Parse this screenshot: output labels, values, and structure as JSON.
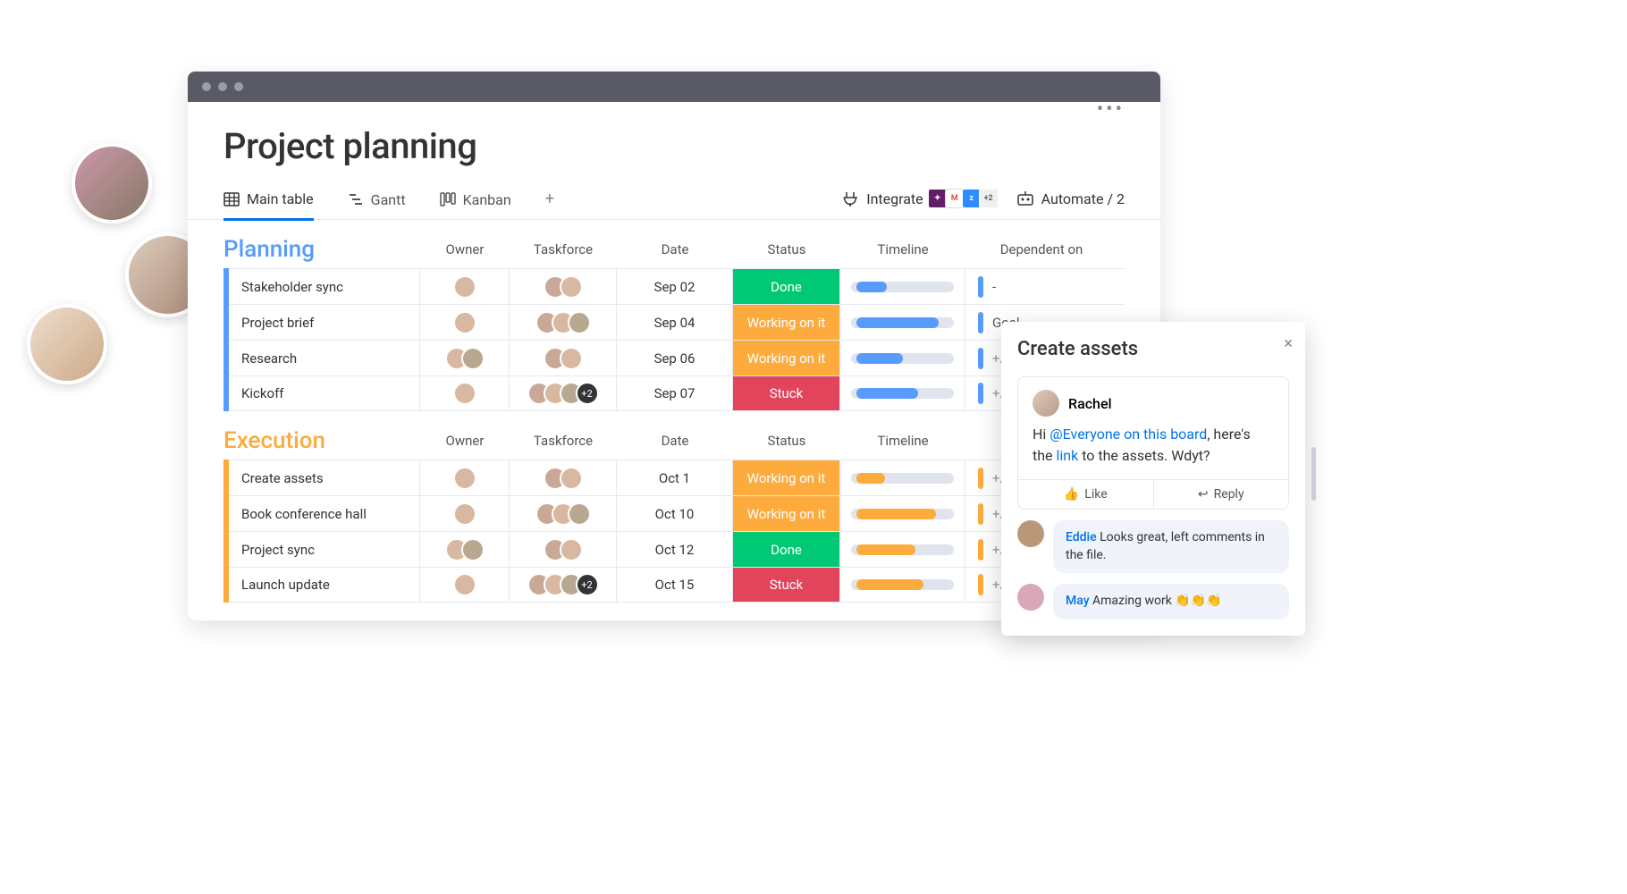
{
  "page_title": "Project planning",
  "tabs": {
    "main": "Main table",
    "gantt": "Gantt",
    "kanban": "Kanban"
  },
  "actions": {
    "integrate": "Integrate",
    "integrate_more": "+2",
    "automate": "Automate / 2"
  },
  "columns": [
    "Owner",
    "Taskforce",
    "Date",
    "Status",
    "Timeline",
    "Dependent on"
  ],
  "groups": [
    {
      "name": "Planning",
      "color": "blue",
      "rows": [
        {
          "name": "Stakeholder sync",
          "owner": 1,
          "taskforce": 2,
          "date": "Sep 02",
          "status": "Done",
          "tl_start": 5,
          "tl_width": 30,
          "tl_color": "blue",
          "dep": "-"
        },
        {
          "name": "Project brief",
          "owner": 1,
          "taskforce": 3,
          "date": "Sep 04",
          "status": "Working on it",
          "tl_start": 5,
          "tl_width": 80,
          "tl_color": "blue",
          "dep": "Goal"
        },
        {
          "name": "Research",
          "owner": 2,
          "taskforce": 2,
          "date": "Sep 06",
          "status": "Working on it",
          "tl_start": 5,
          "tl_width": 45,
          "tl_color": "blue",
          "dep": "+Add"
        },
        {
          "name": "Kickoff",
          "owner": 1,
          "taskforce": 4,
          "tf_more": "+2",
          "date": "Sep 07",
          "status": "Stuck",
          "tl_start": 5,
          "tl_width": 60,
          "tl_color": "blue",
          "dep": "+Add"
        }
      ]
    },
    {
      "name": "Execution",
      "color": "orange",
      "rows": [
        {
          "name": "Create assets",
          "owner": 1,
          "taskforce": 2,
          "date": "Oct 1",
          "status": "Working on it",
          "tl_start": 5,
          "tl_width": 28,
          "tl_color": "orange",
          "dep": "+Add"
        },
        {
          "name": "Book conference hall",
          "owner": 1,
          "taskforce": 3,
          "date": "Oct 10",
          "status": "Working on it",
          "tl_start": 5,
          "tl_width": 78,
          "tl_color": "orange",
          "dep": "+Add"
        },
        {
          "name": "Project sync",
          "owner": 2,
          "taskforce": 2,
          "date": "Oct 12",
          "status": "Done",
          "tl_start": 5,
          "tl_width": 58,
          "tl_color": "orange",
          "dep": "+Add"
        },
        {
          "name": "Launch update",
          "owner": 1,
          "taskforce": 4,
          "tf_more": "+2",
          "date": "Oct 15",
          "status": "Stuck",
          "tl_start": 5,
          "tl_width": 65,
          "tl_color": "orange",
          "dep": "+Add"
        }
      ]
    }
  ],
  "panel": {
    "title": "Create assets",
    "author": "Rachel",
    "body_pre": "Hi ",
    "mention": "@Everyone on this board",
    "body_mid": ", here's the ",
    "link": "link",
    "body_post": " to the assets. Wdyt?",
    "like": "Like",
    "reply": "Reply",
    "replies": [
      {
        "author": "Eddie",
        "text": " Looks great, left comments in the file."
      },
      {
        "author": "May",
        "text": " Amazing work 👏👏👏"
      }
    ]
  }
}
